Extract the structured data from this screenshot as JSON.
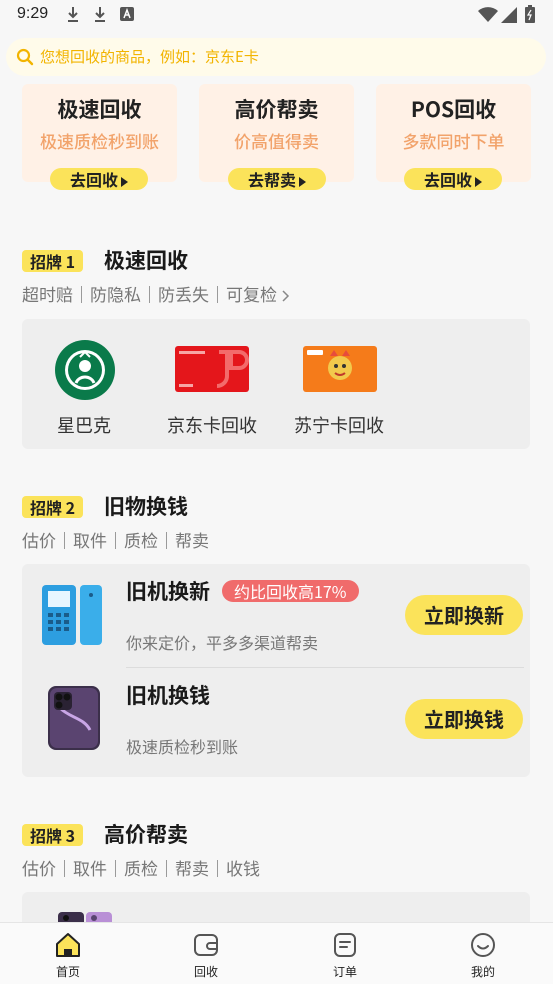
{
  "status_bar": {
    "time": "9:29"
  },
  "search": {
    "placeholder": "您想回收的商品，例如：京东E卡"
  },
  "service_cards": [
    {
      "title": "极速回收",
      "subtitle": "极速质检秒到账",
      "button": "去回收"
    },
    {
      "title": "高价帮卖",
      "subtitle": "价高值得卖",
      "button": "去帮卖"
    },
    {
      "title": "POS回收",
      "subtitle": "多款同时下单",
      "button": "去回收"
    }
  ],
  "section1": {
    "badge": "招牌 1",
    "title": "极速回收",
    "tags": "超时赔｜防隐私｜防丢失｜可复检",
    "brands": [
      {
        "label": "星巴克"
      },
      {
        "label": "京东卡回收"
      },
      {
        "label": "苏宁卡回收"
      }
    ]
  },
  "section2": {
    "badge": "招牌 2",
    "title": "旧物换钱",
    "tags": "估价｜取件｜质检｜帮卖",
    "rows": [
      {
        "title": "旧机换新",
        "tag": "约比回收高17%",
        "subtitle": "你来定价，平多多渠道帮卖",
        "button": "立即换新"
      },
      {
        "title": "旧机换钱",
        "subtitle": "极速质检秒到账",
        "button": "立即换钱"
      }
    ]
  },
  "section3": {
    "badge": "招牌 3",
    "title": "高价帮卖",
    "tags": "估价｜取件｜质检｜帮卖｜收钱"
  },
  "bottom_nav": [
    {
      "label": "首页",
      "icon": "home-icon"
    },
    {
      "label": "回收",
      "icon": "wallet-icon"
    },
    {
      "label": "订单",
      "icon": "order-icon"
    },
    {
      "label": "我的",
      "icon": "profile-icon"
    }
  ],
  "colors": {
    "accent": "#fbe35a",
    "orange_text": "#f2a36b",
    "red_tag": "#f06b6b",
    "card_bg": "#fff1e6"
  }
}
